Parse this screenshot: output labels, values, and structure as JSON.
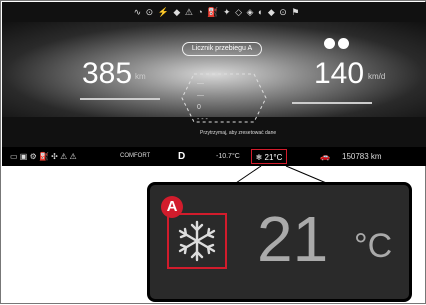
{
  "cluster": {
    "trip_label": "Licznik przebiegu A",
    "speed_value": "385",
    "speed_unit": "km",
    "rate_value": "140",
    "rate_unit": "km/d",
    "prompt_text": "Przytrzymaj, aby zresetować dane",
    "top_icons": "∿ ⊙ ⚡ ◆ ⚠ ◔ ⛽ ✦ ◇ ◈ ◐ ◆ ⊙ ⚑",
    "hex_lines": [
      "—",
      "—",
      "0",
      "- - -"
    ],
    "status": {
      "comfort": "COMFORT",
      "gear": "D",
      "middle": "-10.7°C",
      "temp": "21°C",
      "odometer": "150783 km"
    }
  },
  "callout": {
    "badge": "A",
    "temp_value": "21",
    "temp_unit": "°C",
    "accent": "#d21c2c"
  },
  "icons": {
    "snowflake": "snowflake-icon"
  }
}
